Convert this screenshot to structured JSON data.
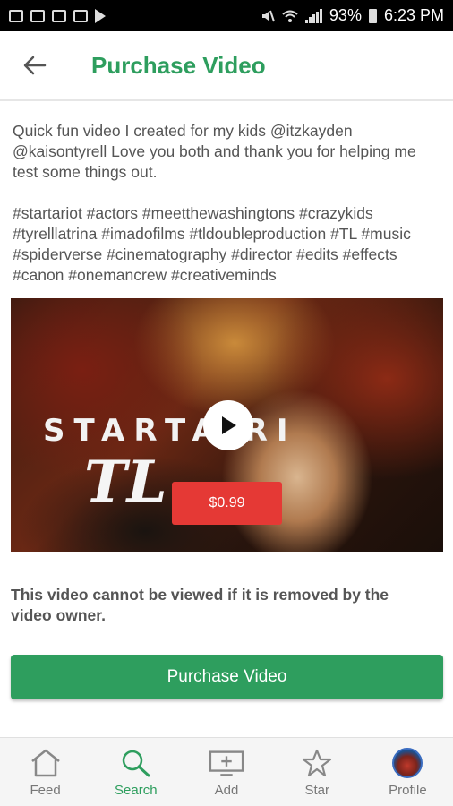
{
  "status_bar": {
    "battery_percent": "93%",
    "time": "6:23 PM"
  },
  "header": {
    "title": "Purchase Video"
  },
  "post": {
    "description": "Quick fun video I created for my kids @itzkayden @kaisontyrell Love you both and thank you for helping me test some things out.",
    "hashtags": "#startariot #actors #meetthewashingtons #crazykids #tyrelllatrina #imadofilms #tldoubleproduction #TL #music #spiderverse #cinematography #director #edits #effects #canon #onemancrew #creativeminds"
  },
  "video": {
    "title_text": "STARTA RI",
    "subtitle_text": "TL",
    "price_label": "$0.99"
  },
  "notice": "This video cannot be viewed if it is removed by the video owner.",
  "purchase_button_label": "Purchase Video",
  "nav": {
    "items": [
      {
        "label": "Feed",
        "icon": "home-icon"
      },
      {
        "label": "Search",
        "icon": "search-icon"
      },
      {
        "label": "Add",
        "icon": "add-icon"
      },
      {
        "label": "Star",
        "icon": "star-icon"
      },
      {
        "label": "Profile",
        "icon": "avatar"
      }
    ]
  },
  "colors": {
    "accent": "#2e9e5e",
    "price": "#e53935"
  }
}
